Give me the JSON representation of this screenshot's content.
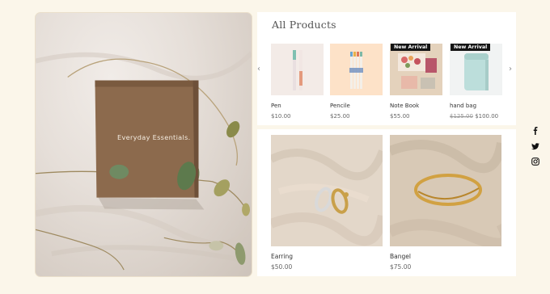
{
  "section": {
    "title": "All Products"
  },
  "hero": {
    "box_text": "Everyday Essentials."
  },
  "carousel": {
    "products": [
      {
        "name": "Pen",
        "price": "$10.00"
      },
      {
        "name": "Pencile",
        "price": "$25.00"
      },
      {
        "name": "Note Book",
        "price": "$55.00",
        "badge": "New Arrival"
      },
      {
        "name": "hand bag",
        "old_price": "$125.00",
        "price": "$100.00",
        "badge": "New Arrival"
      }
    ],
    "prev_icon": "chevron-left-icon",
    "next_icon": "chevron-right-icon"
  },
  "featured": [
    {
      "name": "Earring",
      "price": "$50.00"
    },
    {
      "name": "Bangel",
      "price": "$75.00"
    }
  ],
  "social": [
    "facebook-icon",
    "twitter-icon",
    "instagram-icon"
  ],
  "colors": {
    "background": "#fbf6ea",
    "panel": "#ffffff",
    "badge": "#141414",
    "box": "#8c6a4d"
  }
}
